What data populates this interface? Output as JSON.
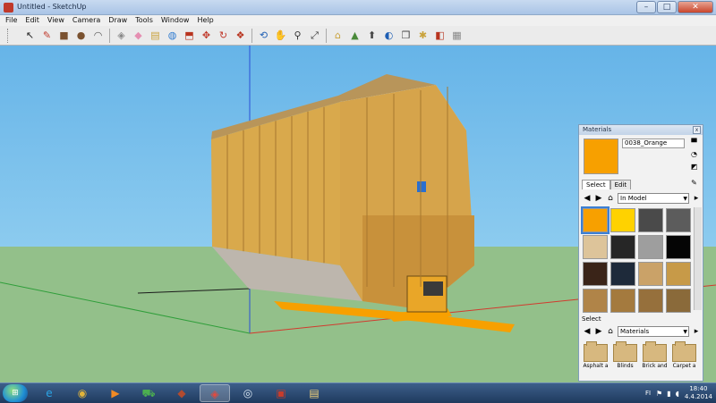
{
  "window": {
    "title": "Untitled - SketchUp",
    "minimize": "–",
    "maximize": "□",
    "close": "✕"
  },
  "menu": [
    "File",
    "Edit",
    "View",
    "Camera",
    "Draw",
    "Tools",
    "Window",
    "Help"
  ],
  "toolbar": {
    "tools": [
      {
        "name": "select-tool-icon",
        "glyph": "↖",
        "color": "#222"
      },
      {
        "name": "pencil-line-tool-icon",
        "glyph": "✎",
        "color": "#c0392b"
      },
      {
        "name": "rectangle-tool-icon",
        "glyph": "■",
        "color": "#7a5230"
      },
      {
        "name": "circle-tool-icon",
        "glyph": "●",
        "color": "#7a5230"
      },
      {
        "name": "arc-tool-icon",
        "glyph": "◠",
        "color": "#555"
      },
      {
        "name": "make-component-icon",
        "glyph": "◈",
        "color": "#888"
      },
      {
        "name": "eraser-tool-icon",
        "glyph": "◆",
        "color": "#e58fb2"
      },
      {
        "name": "tape-measure-icon",
        "glyph": "▤",
        "color": "#c9a23a"
      },
      {
        "name": "paint-bucket-icon",
        "glyph": "◍",
        "color": "#2f7bd0"
      },
      {
        "name": "push-pull-icon",
        "glyph": "⬒",
        "color": "#b8341f"
      },
      {
        "name": "move-tool-icon",
        "glyph": "✥",
        "color": "#c0392b"
      },
      {
        "name": "rotate-tool-icon",
        "glyph": "↻",
        "color": "#c0392b"
      },
      {
        "name": "offset-tool-icon",
        "glyph": "❖",
        "color": "#b8341f"
      },
      {
        "name": "orbit-tool-icon",
        "glyph": "⟲",
        "color": "#1f5fb4"
      },
      {
        "name": "pan-tool-icon",
        "glyph": "✋",
        "color": "#444"
      },
      {
        "name": "zoom-tool-icon",
        "glyph": "⚲",
        "color": "#333"
      },
      {
        "name": "zoom-extents-icon",
        "glyph": "⤢",
        "color": "#333"
      },
      {
        "name": "add-location-icon",
        "glyph": "⌂",
        "color": "#c9a23a"
      },
      {
        "name": "toggle-terrain-icon",
        "glyph": "▲",
        "color": "#4a8a3a"
      },
      {
        "name": "get-models-icon",
        "glyph": "⬆",
        "color": "#444"
      },
      {
        "name": "share-model-icon",
        "glyph": "◐",
        "color": "#1f5fb4"
      },
      {
        "name": "component-icon",
        "glyph": "❒",
        "color": "#444"
      },
      {
        "name": "extension-warehouse-icon",
        "glyph": "✱",
        "color": "#c9a23a"
      },
      {
        "name": "send-to-layout-icon",
        "glyph": "◧",
        "color": "#b8341f"
      },
      {
        "name": "preferences-icon",
        "glyph": "▦",
        "color": "#888"
      }
    ]
  },
  "colors": {
    "ground": "#93c08a",
    "model_orange": "#f7a000",
    "axis_red": "#d23a2e",
    "axis_green": "#2f9e3a",
    "axis_blue": "#2a4fd6"
  },
  "materials_panel": {
    "title": "Materials",
    "close": "x",
    "current_material": "0038_Orange",
    "tabs": [
      "Select",
      "Edit"
    ],
    "library": "In Model",
    "swatches": [
      "#f7a000",
      "#ffd200",
      "#4a4a4a",
      "#5c5c5c",
      "#ddc49a",
      "#262626",
      "#9e9e9e",
      "#050505",
      "#3a2418",
      "#1e2a3a",
      "#caa268",
      "#c79a48",
      "#b08448",
      "#a47a3e",
      "#96703c",
      "#8a6a3a"
    ],
    "secondary_label": "Select",
    "secondary_library": "Materials",
    "folders": [
      "Asphalt a",
      "Blinds",
      "Brick and",
      "Carpet a"
    ]
  },
  "taskbar": {
    "start": "⊞",
    "apps": [
      {
        "name": "ie-icon",
        "glyph": "e",
        "color": "#2aa5e6"
      },
      {
        "name": "chrome-icon",
        "glyph": "◉",
        "color": "#e0b33a"
      },
      {
        "name": "media-player-icon",
        "glyph": "▶",
        "color": "#f08a24"
      },
      {
        "name": "tractor-icon",
        "glyph": "⛟",
        "color": "#4caf50"
      },
      {
        "name": "game-icon",
        "glyph": "◆",
        "color": "#b24b2f"
      },
      {
        "name": "sketchup-icon",
        "glyph": "◈",
        "color": "#e04a3f"
      },
      {
        "name": "steam-icon",
        "glyph": "◎",
        "color": "#d8e6f2"
      },
      {
        "name": "farm-icon",
        "glyph": "▣",
        "color": "#c73c2c"
      },
      {
        "name": "folder-icon",
        "glyph": "▤",
        "color": "#f2d27a"
      }
    ],
    "lang": "FI",
    "time": "18:40",
    "date": "4.4.2014"
  }
}
